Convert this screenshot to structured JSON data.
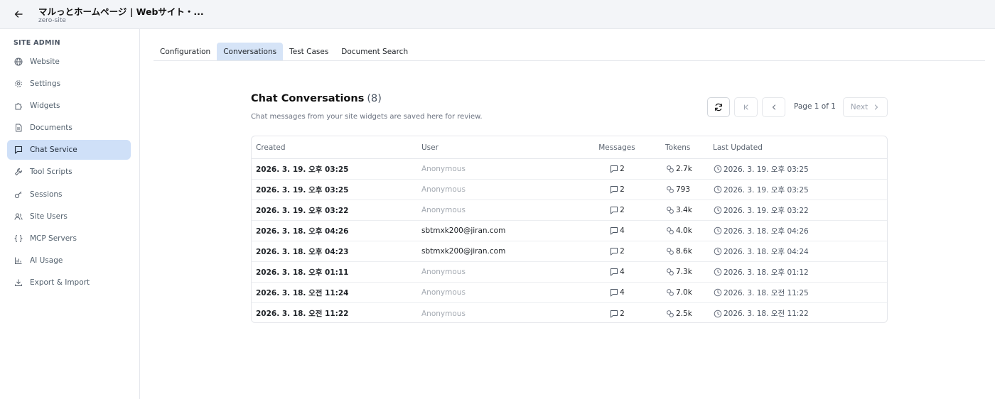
{
  "header": {
    "title": "マルっとホームページ | Webサイト・...",
    "subtitle": "zero-site",
    "back_icon": "arrow-left-icon"
  },
  "sidebar": {
    "heading": "SITE ADMIN",
    "items": [
      {
        "label": "Website",
        "icon": "globe-icon"
      },
      {
        "label": "Settings",
        "icon": "gear-icon"
      },
      {
        "label": "Widgets",
        "icon": "puzzle-icon"
      },
      {
        "label": "Documents",
        "icon": "document-icon"
      },
      {
        "label": "Chat Service",
        "icon": "chat-icon",
        "active": true
      },
      {
        "label": "Tool Scripts",
        "icon": "wrench-icon"
      },
      {
        "label": "Sessions",
        "icon": "key-icon"
      },
      {
        "label": "Site Users",
        "icon": "users-icon"
      },
      {
        "label": "MCP Servers",
        "icon": "braces-icon"
      },
      {
        "label": "AI Usage",
        "icon": "bar-chart-icon"
      },
      {
        "label": "Export & Import",
        "icon": "download-icon"
      }
    ]
  },
  "tabs": [
    {
      "label": "Configuration"
    },
    {
      "label": "Conversations",
      "active": true
    },
    {
      "label": "Test Cases"
    },
    {
      "label": "Document Search"
    }
  ],
  "conversations": {
    "title": "Chat Conversations",
    "count": "(8)",
    "description": "Chat messages from your site widgets are saved here for review.",
    "pagination": {
      "page_label": "Page 1 of 1",
      "next_label": "Next",
      "first_icon": "first-page-icon",
      "prev_icon": "chevron-left-icon",
      "next_icon": "chevron-right-icon",
      "refresh_icon": "refresh-icon"
    },
    "columns": {
      "created": "Created",
      "user": "User",
      "messages": "Messages",
      "tokens": "Tokens",
      "last_updated": "Last Updated"
    },
    "rows": [
      {
        "created": "2026. 3. 19. 오후 03:25",
        "user": "Anonymous",
        "anon": true,
        "messages": "2",
        "tokens": "2.7k",
        "updated": "2026. 3. 19. 오후 03:25"
      },
      {
        "created": "2026. 3. 19. 오후 03:25",
        "user": "Anonymous",
        "anon": true,
        "messages": "2",
        "tokens": "793",
        "updated": "2026. 3. 19. 오후 03:25"
      },
      {
        "created": "2026. 3. 19. 오후 03:22",
        "user": "Anonymous",
        "anon": true,
        "messages": "2",
        "tokens": "3.4k",
        "updated": "2026. 3. 19. 오후 03:22"
      },
      {
        "created": "2026. 3. 18. 오후 04:26",
        "user": "sbtmxk200@jiran.com",
        "anon": false,
        "messages": "4",
        "tokens": "4.0k",
        "updated": "2026. 3. 18. 오후 04:26"
      },
      {
        "created": "2026. 3. 18. 오후 04:23",
        "user": "sbtmxk200@jiran.com",
        "anon": false,
        "messages": "2",
        "tokens": "8.6k",
        "updated": "2026. 3. 18. 오후 04:24"
      },
      {
        "created": "2026. 3. 18. 오후 01:11",
        "user": "Anonymous",
        "anon": true,
        "messages": "4",
        "tokens": "7.3k",
        "updated": "2026. 3. 18. 오후 01:12"
      },
      {
        "created": "2026. 3. 18. 오전 11:24",
        "user": "Anonymous",
        "anon": true,
        "messages": "4",
        "tokens": "7.0k",
        "updated": "2026. 3. 18. 오전 11:25"
      },
      {
        "created": "2026. 3. 18. 오전 11:22",
        "user": "Anonymous",
        "anon": true,
        "messages": "2",
        "tokens": "2.5k",
        "updated": "2026. 3. 18. 오전 11:22"
      }
    ]
  },
  "colors": {
    "active_bg": "#cfe0f8",
    "tab_active_bg": "#d6e4f7",
    "anon_text": "#a4aab2"
  }
}
